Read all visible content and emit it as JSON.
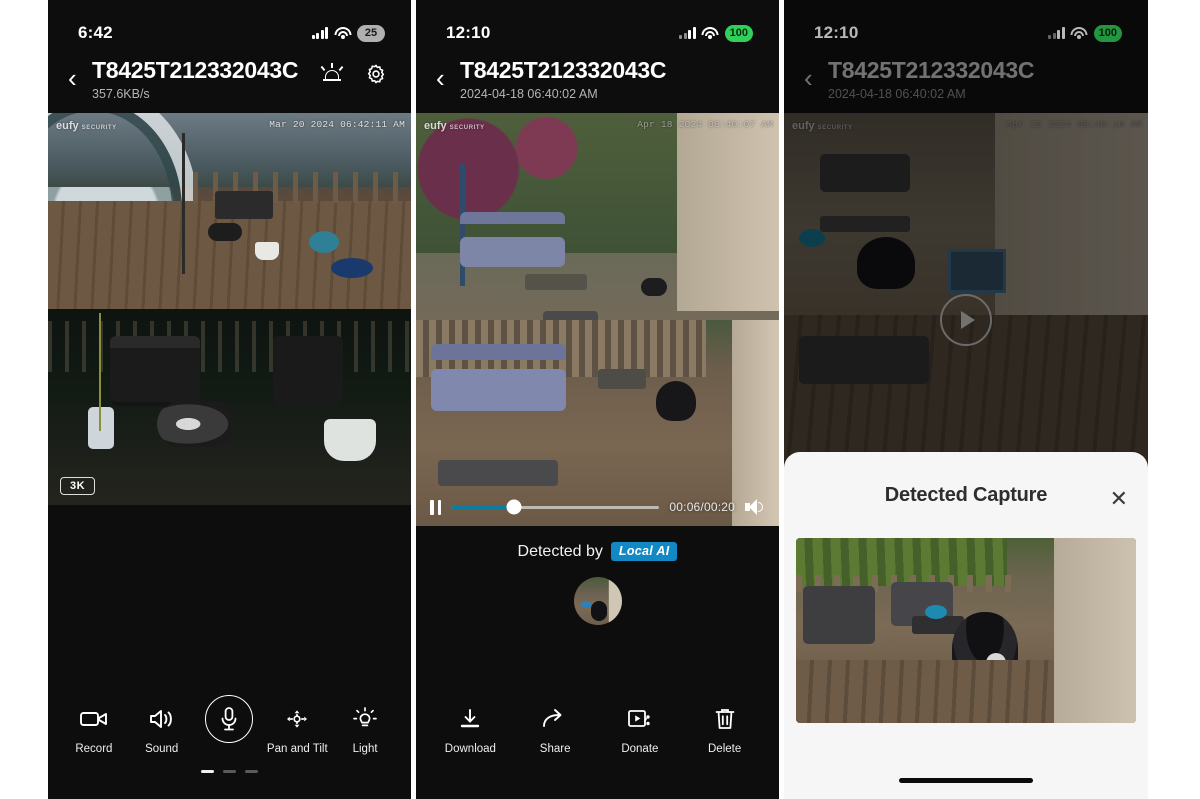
{
  "panels": [
    {
      "id": "live-view",
      "status": {
        "time": "6:42",
        "battery": "25",
        "battery_state": "low",
        "signal_icon": "cellular-bars-icon",
        "wifi_icon": "wifi-icon"
      },
      "nav": {
        "back_icon": "chevron-left-icon",
        "title": "T8425T212332043C",
        "subtitle": "357.6KB/s",
        "siren_icon": "siren-icon",
        "gear_icon": "gear-icon"
      },
      "cameras": [
        {
          "watermark": "eufy",
          "watermark_sub": "SECURITY",
          "timestamp": "Mar 20 2024  06:42:11 AM"
        },
        {
          "quality_badge": "3K"
        }
      ],
      "toolbar": [
        {
          "label": "Record",
          "icon": "video-camera-icon"
        },
        {
          "label": "Sound",
          "icon": "speaker-icon"
        },
        {
          "label": "",
          "icon": "microphone-icon"
        },
        {
          "label": "Pan and Tilt",
          "icon": "pan-tilt-icon"
        },
        {
          "label": "Light",
          "icon": "light-bulb-icon"
        }
      ],
      "page_dots": {
        "count": 3,
        "active": 0
      }
    },
    {
      "id": "event-playback",
      "status": {
        "time": "12:10",
        "battery": "100",
        "battery_state": "full",
        "signal_icon": "cellular-bars-icon",
        "wifi_icon": "wifi-icon"
      },
      "nav": {
        "back_icon": "chevron-left-icon",
        "title": "T8425T212332043C",
        "subtitle": "2024-04-18 06:40:02 AM"
      },
      "cameras": [
        {
          "watermark": "eufy",
          "watermark_sub": "SECURITY",
          "timestamp": "Apr 18 2024  06:40:07 AM"
        },
        {
          "timestamp": ""
        }
      ],
      "player": {
        "pause_icon": "pause-icon",
        "time": "00:06/00:20",
        "progress_percent": 30,
        "volume_icon": "speaker-icon"
      },
      "detected": {
        "label": "Detected by",
        "badge": "Local AI",
        "thumb": "detection-thumbnail"
      },
      "toolbar": [
        {
          "label": "Download",
          "icon": "download-icon"
        },
        {
          "label": "Share",
          "icon": "share-arrow-icon"
        },
        {
          "label": "Donate",
          "icon": "donate-video-icon"
        },
        {
          "label": "Delete",
          "icon": "trash-icon"
        }
      ]
    },
    {
      "id": "detected-capture-sheet",
      "status": {
        "time": "12:10",
        "battery": "100",
        "battery_state": "full",
        "signal_icon": "cellular-bars-icon",
        "wifi_icon": "wifi-icon"
      },
      "nav": {
        "back_icon": "chevron-left-icon",
        "title": "T8425T212332043C",
        "subtitle": "2024-04-18 06:40:02 AM"
      },
      "cameras": [
        {
          "watermark": "eufy",
          "watermark_sub": "SECURITY",
          "timestamp": "Apr 18 2024  06:40:10 AM",
          "play_icon": "play-icon"
        }
      ],
      "sheet": {
        "title": "Detected Capture",
        "close_icon": "close-icon",
        "image": "detected-capture-image"
      },
      "home_indicator": "home-indicator"
    }
  ],
  "colors": {
    "phone_bg": "#0d0d0d",
    "accent_blue": "#0e7c9e",
    "localai_blue": "#1288c4",
    "battery_full": "#30d158",
    "battery_low": "#b0b0b0",
    "sheet_bg": "#f6f6f7"
  }
}
